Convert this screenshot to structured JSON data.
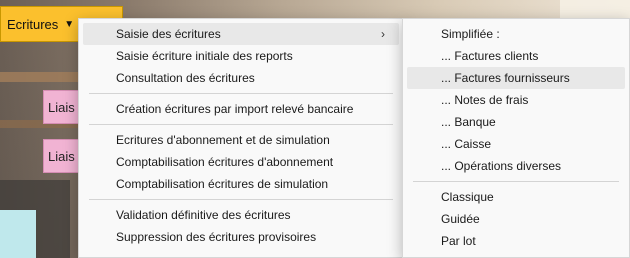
{
  "top_button": {
    "label": "Ecritures",
    "caret": "▼",
    "color": "#fbc02d"
  },
  "tiles": [
    {
      "label": "Liais"
    },
    {
      "label": "Liais"
    }
  ],
  "menu1": {
    "groups": [
      [
        {
          "label": "Saisie des écritures",
          "submenu": true,
          "arrow": "›"
        },
        {
          "label": "Saisie écriture initiale des reports"
        },
        {
          "label": "Consultation des écritures"
        }
      ],
      [
        {
          "label": "Création écritures par import relevé bancaire"
        }
      ],
      [
        {
          "label": "Ecritures d'abonnement et de simulation"
        },
        {
          "label": "Comptabilisation écritures d'abonnement"
        },
        {
          "label": "Comptabilisation écritures de simulation"
        }
      ],
      [
        {
          "label": "Validation définitive des écritures"
        },
        {
          "label": "Suppression des écritures provisoires"
        }
      ]
    ]
  },
  "menu2": {
    "groups": [
      [
        {
          "label": "Simplifiée :"
        },
        {
          "label": "... Factures clients"
        },
        {
          "label": "... Factures fournisseurs"
        },
        {
          "label": "... Notes de frais"
        },
        {
          "label": "... Banque"
        },
        {
          "label": "... Caisse"
        },
        {
          "label": "... Opérations diverses"
        }
      ],
      [
        {
          "label": "Classique"
        },
        {
          "label": "Guidée"
        },
        {
          "label": "Par lot"
        }
      ]
    ]
  },
  "colors": {
    "highlight": "#e8e8e8",
    "menu_bg": "#f9f9f9",
    "tile_pink": "#f1b3d3"
  }
}
